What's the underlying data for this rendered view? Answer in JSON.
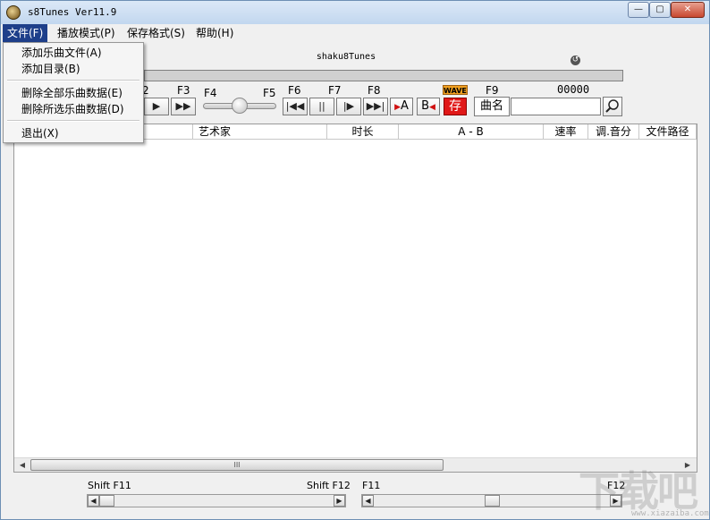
{
  "window": {
    "title": "s8Tunes Ver11.9",
    "buttons": {
      "minimize": "—",
      "maximize": "▢",
      "close": "✕"
    }
  },
  "menubar": {
    "items": [
      {
        "label": "文件(F)",
        "active": true
      },
      {
        "label": "播放模式(P)",
        "active": false
      },
      {
        "label": "保存格式(S)",
        "active": false
      },
      {
        "label": "帮助(H)",
        "active": false
      }
    ]
  },
  "file_menu": {
    "items": [
      {
        "label": "添加乐曲文件(A)"
      },
      {
        "label": "添加目录(B)"
      },
      {
        "label": "删除全部乐曲数据(E)"
      },
      {
        "label": "删除所选乐曲数据(D)"
      },
      {
        "label": "退出(X)"
      }
    ]
  },
  "player": {
    "song_title": "shaku8Tunes",
    "progress_fraction": 0,
    "counter": "00000",
    "volume_fraction": 0.5,
    "function_keys": {
      "f2": "2",
      "f3": "F3",
      "f4": "F4",
      "f5": "F5",
      "f6": "F6",
      "f7": "F7",
      "f8": "F8",
      "f9": "F9"
    },
    "buttons": {
      "play_partial": "▶",
      "fast_forward": "▶▶",
      "prev": "|◀◀",
      "pause": "||",
      "play": "|▶",
      "next": "▶▶|",
      "a_point": "A",
      "b_point": "B",
      "wave": "WAVE",
      "save": "存",
      "name_label": "曲名"
    },
    "search": {
      "value": "",
      "placeholder": ""
    }
  },
  "list": {
    "columns": [
      {
        "label": "艺术家"
      },
      {
        "label": "时长"
      },
      {
        "label": "A - B"
      },
      {
        "label": "速率"
      },
      {
        "label": "调.音分"
      },
      {
        "label": "文件路径"
      }
    ],
    "rows": [],
    "scroll_grip": "III"
  },
  "bottom": {
    "left_slider": {
      "start_label": "Shift F11",
      "end_label": "Shift F12",
      "value_fraction": 0
    },
    "right_slider": {
      "start_label": "F11",
      "end_label": "F12",
      "value_fraction": 0.5
    }
  },
  "watermark": {
    "text": "下载吧",
    "url": "www.xiazaiba.com"
  },
  "colors": {
    "menu_active": "#1e3f8a",
    "save_red": "#e01818",
    "wave_badge": "#f0a020"
  }
}
